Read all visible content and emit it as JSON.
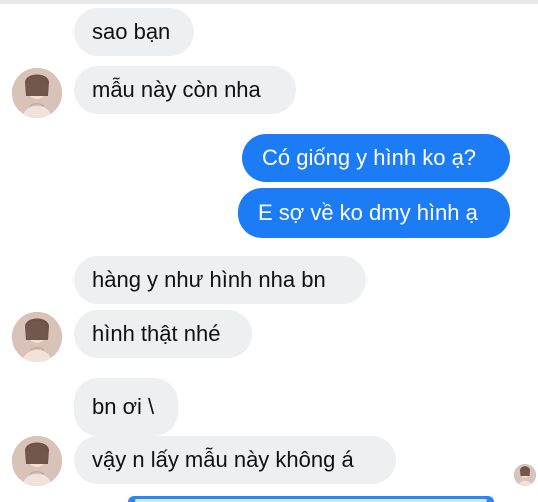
{
  "chat": {
    "messages": [
      {
        "sender": "contact",
        "text": "sao bạn"
      },
      {
        "sender": "contact",
        "text": "mẫu này còn nha"
      },
      {
        "sender": "me",
        "text": "Có giống y hình ko ạ?"
      },
      {
        "sender": "me",
        "text": "E sợ về ko dmy hình ạ"
      },
      {
        "sender": "contact",
        "text": "hàng y như hình nha bn"
      },
      {
        "sender": "contact",
        "text": "hình thật nhé"
      },
      {
        "sender": "contact",
        "text": "bn ơi \\"
      },
      {
        "sender": "contact",
        "text": "vậy n lấy mẫu này không á"
      }
    ]
  },
  "colors": {
    "incoming_bubble": "#eeeff1",
    "outgoing_bubble": "#1c7cf5",
    "background": "#ffffff"
  },
  "icons": {
    "avatar": "contact-avatar-icon",
    "seen": "seen-avatar-icon"
  }
}
